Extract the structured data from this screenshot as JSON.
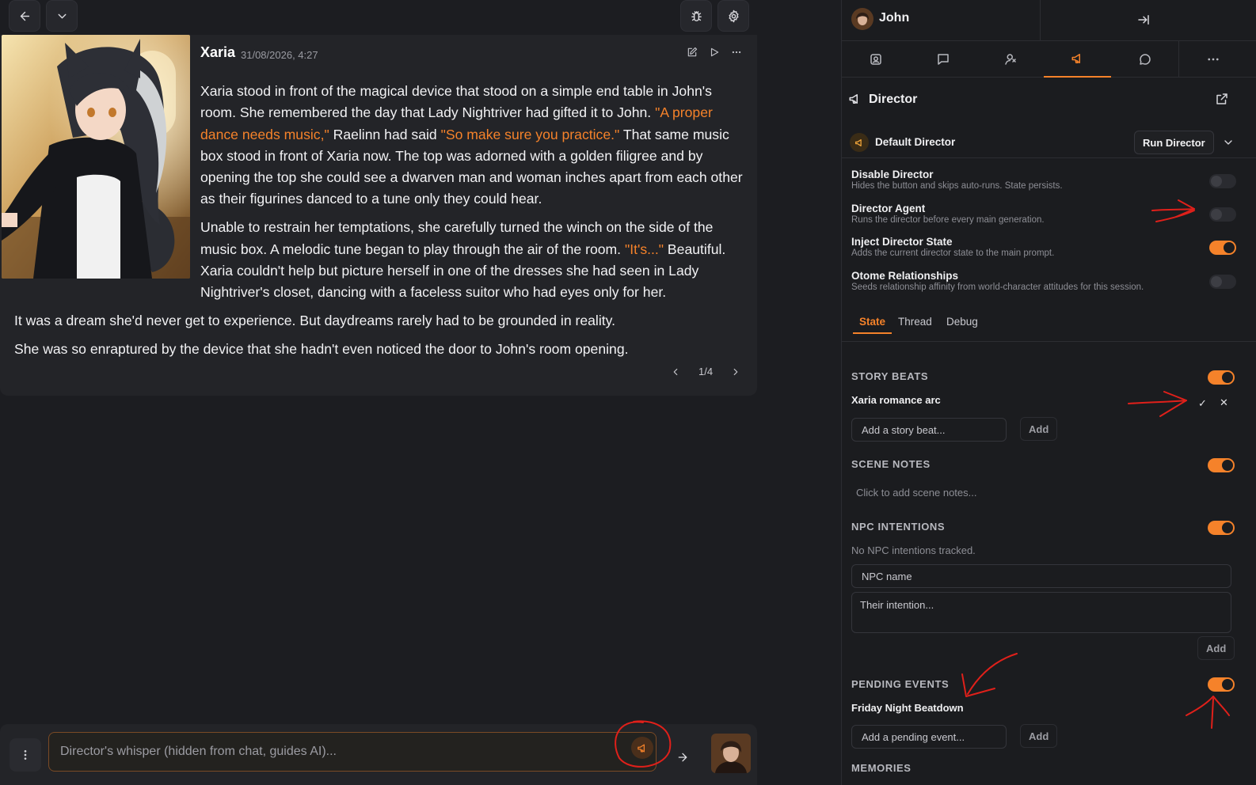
{
  "toolbar": {
    "back_icon": "arrow-left-icon",
    "collapse_icon": "chevron-down-icon",
    "debug_icon": "bug-icon",
    "settings_icon": "gear-icon"
  },
  "message": {
    "author": "Xaria",
    "timestamp": "31/08/2026, 4:27",
    "paragraphs": [
      [
        {
          "t": "Xaria stood in front of the magical device that stood on a simple end table in John's room. She remembered the day that Lady Nightriver had gifted it to John. ",
          "q": false
        },
        {
          "t": "\"A proper dance needs music,\"",
          "q": true
        },
        {
          "t": " Raelinn had said ",
          "q": false
        },
        {
          "t": "\"So make sure you practice.\"",
          "q": true
        },
        {
          "t": " That same music box stood in front of Xaria now. The top was adorned with a golden filigree and by opening the top she could see a dwarven man and woman inches apart from each other as their figurines danced to a tune only they could hear.",
          "q": false
        }
      ],
      [
        {
          "t": "Unable to restrain her temptations, she carefully turned the winch on the side of the music box. A melodic tune began to play through the air of the room. ",
          "q": false
        },
        {
          "t": "\"It's...\"",
          "q": true
        },
        {
          "t": " Beautiful. Xaria couldn't help but picture herself in one of the dresses she had seen in Lady Nightriver's closet, dancing with a faceless suitor who had eyes only for her.",
          "q": false
        }
      ],
      [
        {
          "t": "It was a dream she'd never get to experience. But daydreams rarely had to be grounded in reality.",
          "q": false
        }
      ],
      [
        {
          "t": "She was so enraptured by the device that she hadn't even noticed the door to John's room opening.",
          "q": false
        }
      ]
    ],
    "pager": "1/4",
    "quote_color": "#f5822a"
  },
  "composer": {
    "placeholder": "Director's whisper (hidden from chat, guides AI)...",
    "value": ""
  },
  "panel": {
    "user_name": "John",
    "tabs": [
      "scene-icon",
      "chat-icon",
      "persona-icon",
      "megaphone-icon",
      "bubble-icon",
      "more-icon"
    ],
    "active_tab": 3,
    "title": "Director",
    "director_name": "Default Director",
    "run_label": "Run Director",
    "settings": [
      {
        "title": "Disable Director",
        "desc": "Hides the button and skips auto-runs. State persists.",
        "on": false
      },
      {
        "title": "Director Agent",
        "desc": "Runs the director before every main generation.",
        "on": false
      },
      {
        "title": "Inject Director State",
        "desc": "Adds the current director state to the main prompt.",
        "on": true
      },
      {
        "title": "Otome Relationships",
        "desc": "Seeds relationship affinity from world-character attitudes for this session.",
        "on": false
      }
    ],
    "sub_tabs": [
      "State",
      "Thread",
      "Debug"
    ],
    "active_sub_tab": 0,
    "story_beats": {
      "title": "STORY BEATS",
      "on": true,
      "items": [
        "Xaria romance arc"
      ],
      "placeholder": "Add a story beat...",
      "add_label": "Add"
    },
    "scene_notes": {
      "title": "SCENE NOTES",
      "on": true,
      "placeholder": "Click to add scene notes..."
    },
    "npc_intentions": {
      "title": "NPC INTENTIONS",
      "on": true,
      "empty_text": "No NPC intentions tracked.",
      "name_placeholder": "NPC name",
      "intent_placeholder": "Their intention...",
      "add_label": "Add"
    },
    "pending_events": {
      "title": "PENDING EVENTS",
      "on": true,
      "items": [
        "Friday Night Beatdown"
      ],
      "placeholder": "Add a pending event...",
      "add_label": "Add"
    },
    "memories": {
      "title": "MEMORIES"
    },
    "accent": "#f5822a"
  }
}
